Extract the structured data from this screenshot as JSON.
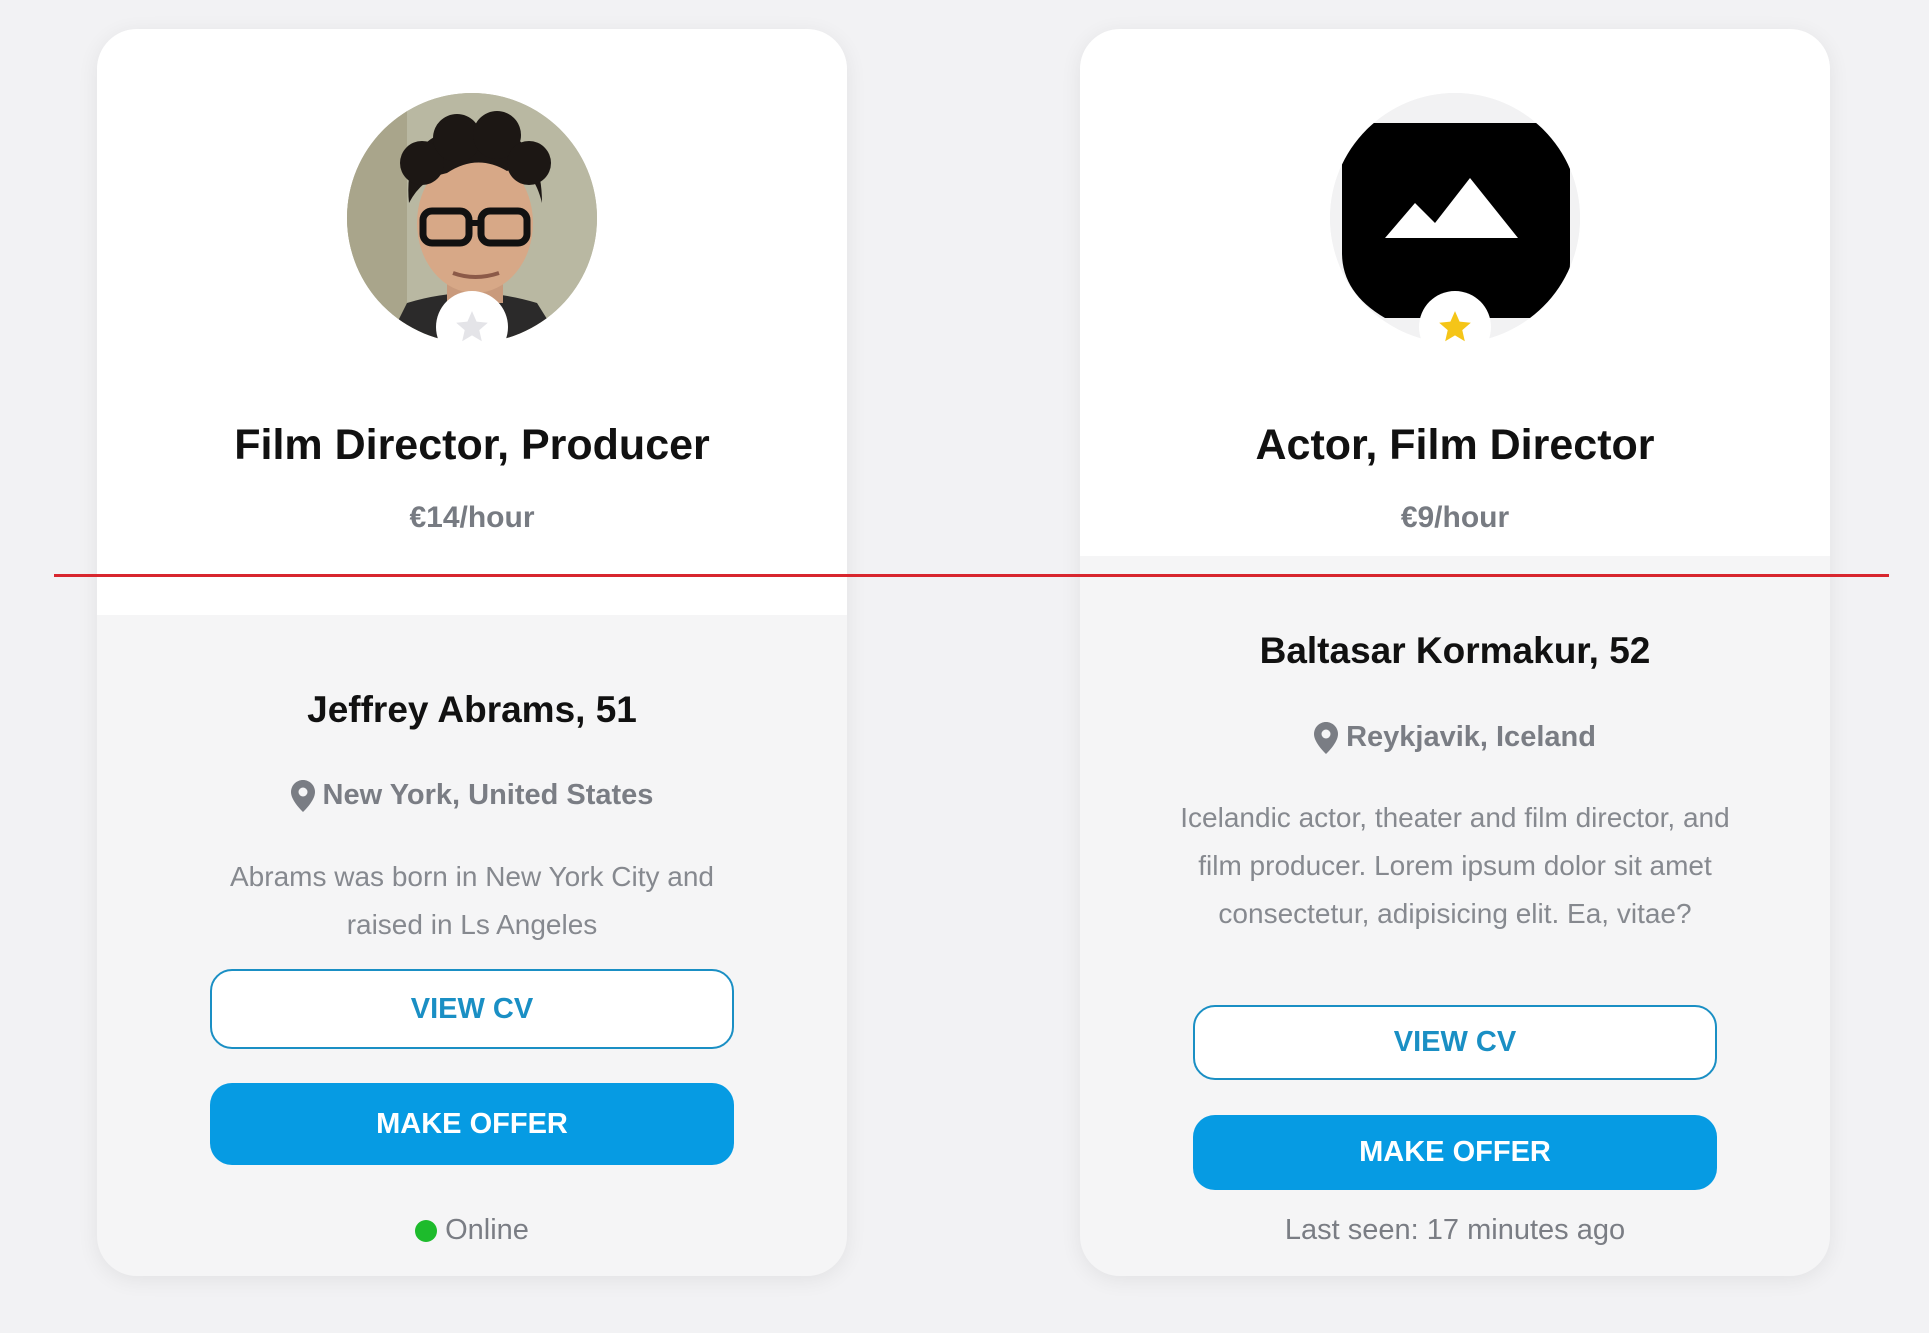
{
  "cards": [
    {
      "title": "Film Director, Producer",
      "rate": "€14/hour",
      "name": "Jeffrey Abrams, 51",
      "location": "New York, United States",
      "bio": "Abrams was born in New York City and raised in Ls Angeles",
      "view_cv_label": "VIEW CV",
      "make_offer_label": "MAKE OFFER",
      "status": "Online",
      "featured": false
    },
    {
      "title": "Actor, Film Director",
      "rate": "€9/hour",
      "name": "Baltasar Kormakur, 52",
      "location": "Reykjavik, Iceland",
      "bio": "Icelandic actor, theater and film director, and film producer. Lorem ipsum dolor sit amet consectetur, adipisicing elit. Ea, vitae?",
      "view_cv_label": "VIEW CV",
      "make_offer_label": "MAKE OFFER",
      "status": "Last seen: 17 minutes ago",
      "featured": true
    }
  ],
  "colors": {
    "accent": "#069be3",
    "outline": "#1a8fc4",
    "online": "#1dbb2c",
    "star_inactive": "#e4e4e8",
    "star_active": "#f5c518",
    "divider_line": "#d8262e"
  }
}
